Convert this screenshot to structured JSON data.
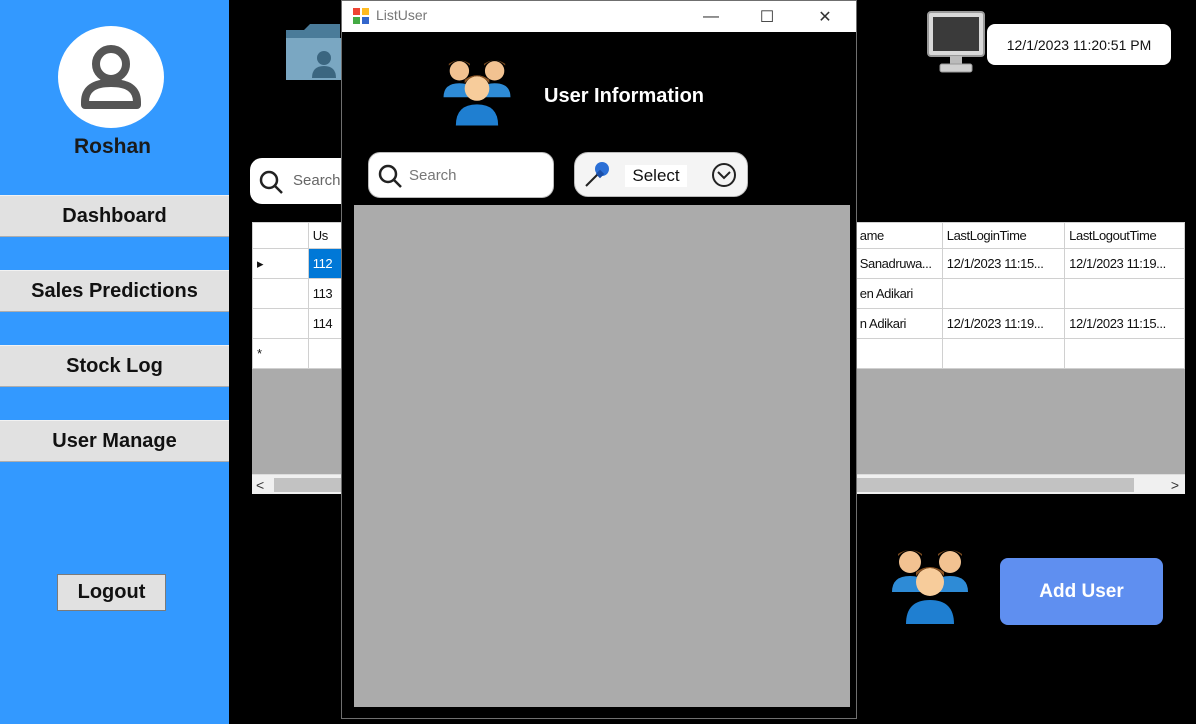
{
  "sidebar": {
    "username": "Roshan",
    "nav": [
      {
        "label": "Dashboard"
      },
      {
        "label": "Sales Predictions"
      },
      {
        "label": "Stock Log"
      },
      {
        "label": "User Manage"
      }
    ],
    "logout_label": "Logout",
    "background_color": "#3399ff"
  },
  "header": {
    "datetime": "12/1/2023 11:20:51 PM"
  },
  "main": {
    "search_placeholder": "Search",
    "grid": {
      "columns": [
        "Us",
        "ame",
        "LastLoginTime",
        "LastLogoutTime"
      ],
      "rows": [
        {
          "marker": "▸",
          "id": "112",
          "name": "Sanadruwa...",
          "last_login": "12/1/2023 11:15...",
          "last_logout": "12/1/2023 11:19..."
        },
        {
          "marker": "",
          "id": "113",
          "name": "en  Adikari",
          "last_login": "",
          "last_logout": ""
        },
        {
          "marker": "",
          "id": "114",
          "name": "n Adikari",
          "last_login": "12/1/2023 11:19...",
          "last_logout": "12/1/2023 11:15..."
        },
        {
          "marker": "*",
          "id": "",
          "name": "",
          "last_login": "",
          "last_logout": ""
        }
      ]
    },
    "add_user_label": "Add User",
    "accent_color": "#5f8ff0"
  },
  "modal": {
    "window_title": "ListUser",
    "heading": "User Information",
    "search_placeholder": "Search",
    "select_label": "Select",
    "buttons": {
      "minimize": "—",
      "maximize": "☐",
      "close": "✕"
    }
  },
  "icons": [
    "user-avatar-icon",
    "folder-user-icon",
    "monitor-icon",
    "users-group-icon",
    "search-icon",
    "pin-icon",
    "chevron-down-circle-icon",
    "app-window-icon"
  ]
}
